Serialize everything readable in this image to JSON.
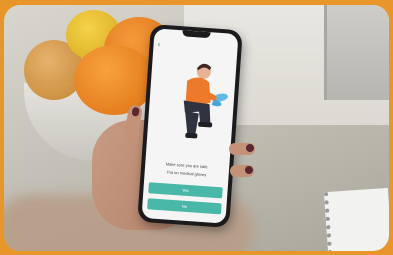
{
  "screen": {
    "back_icon": "‹",
    "prompt_title": "Make sure you are safe.",
    "prompt_sub": "Put on medical gloves",
    "buttons": {
      "yes_label": "Yes",
      "no_label": "No"
    },
    "accent_color": "#49b8a8"
  }
}
